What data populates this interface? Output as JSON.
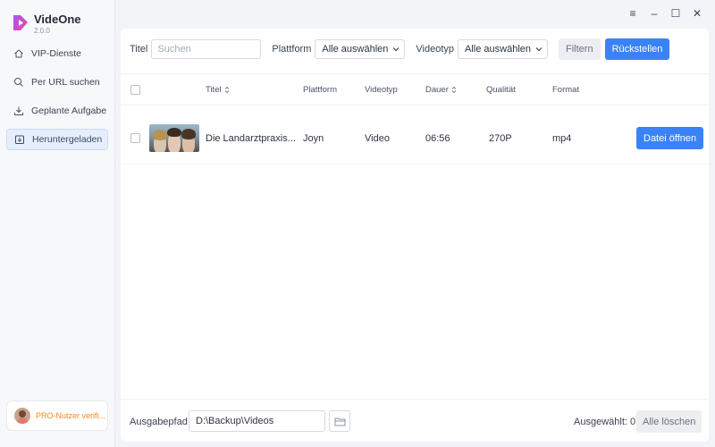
{
  "app": {
    "name": "VideOne",
    "version": "2.0.0"
  },
  "window_controls": {
    "menu": "≡",
    "minimize": "–",
    "maximize": "☐",
    "close": "✕"
  },
  "sidebar": {
    "items": [
      {
        "label": "VIP-Dienste",
        "icon": "home-icon"
      },
      {
        "label": "Per URL suchen",
        "icon": "search-icon"
      },
      {
        "label": "Geplante Aufgabe",
        "icon": "download-icon"
      },
      {
        "label": "Heruntergeladen",
        "icon": "downloaded-icon",
        "active": true
      }
    ],
    "pro_user": "PRO-Nutzer verifi..."
  },
  "filters": {
    "title_label": "Titel",
    "search_placeholder": "Suchen",
    "platform_label": "Plattform",
    "platform_value": "Alle auswählen",
    "videotype_label": "Videotyp",
    "videotype_value": "Alle auswählen",
    "filter_button": "Filtern",
    "reset_button": "Rückstellen"
  },
  "table": {
    "headers": {
      "title": "Titel",
      "platform": "Plattform",
      "videotype": "Videotyp",
      "duration": "Dauer",
      "quality": "Qualität",
      "format": "Format"
    },
    "rows": [
      {
        "title": "Die Landarztpraxis...",
        "platform": "Joyn",
        "videotype": "Video",
        "duration": "06:56",
        "quality": "270P",
        "format": "mp4",
        "action": "Datei öffnen"
      }
    ]
  },
  "footer": {
    "output_label": "Ausgabepfad",
    "output_path": "D:\\Backup\\Videos",
    "selected": "Ausgewählt: 0",
    "clear_button": "Alle löschen"
  },
  "colors": {
    "accent": "#3b82f6",
    "pro": "#f08a24",
    "background": "#f2f4f7"
  }
}
